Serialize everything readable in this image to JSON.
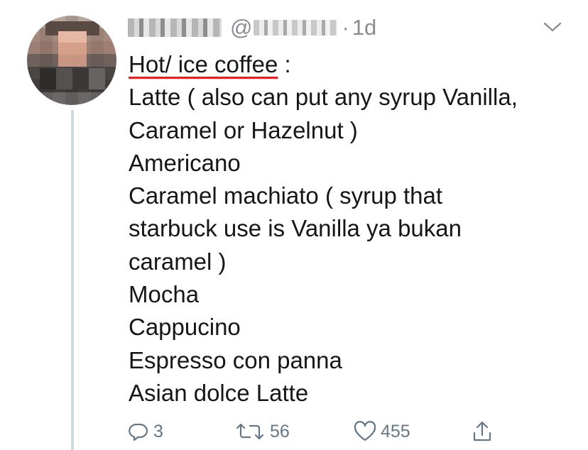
{
  "tweet": {
    "display_name": "",
    "handle_prefix": "@",
    "separator": "·",
    "timestamp": "1d",
    "heading": "Hot/ ice coffee",
    "heading_suffix": " :",
    "lines": [
      "Latte ( also can put any syrup Vanilla,",
      "Caramel or Hazelnut )",
      "Americano",
      "Caramel machiato ( syrup that",
      "starbuck use is Vanilla ya bukan",
      "caramel )",
      "Mocha",
      "Cappucino",
      "Espresso con panna",
      "Asian dolce Latte"
    ]
  },
  "actions": {
    "reply_count": "3",
    "retweet_count": "56",
    "like_count": "455"
  },
  "icons": {
    "reply": "reply-icon",
    "retweet": "retweet-icon",
    "like": "heart-icon",
    "share": "share-icon",
    "menu": "chevron-down-icon"
  },
  "colors": {
    "text": "#14171a",
    "muted": "#657786",
    "thread_line": "#cfd9de",
    "underline": "#e02323"
  }
}
